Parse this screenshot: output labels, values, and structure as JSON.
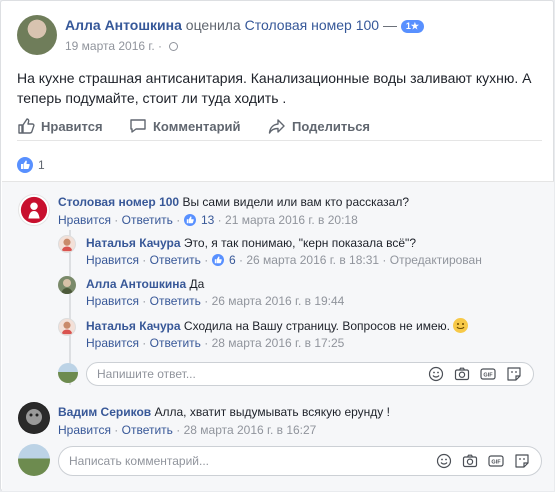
{
  "post": {
    "author": "Алла Антошкина",
    "verb": "оценила",
    "page": "Столовая номер 100",
    "dash": "—",
    "rating": "1★",
    "date": "19 марта 2016 г.",
    "dot": "·",
    "text": "На кухне страшная антисанитария. Канализационные воды заливают кухню. А теперь подумайте, стоит ли туда ходить ."
  },
  "actions": {
    "like": "Нравится",
    "comment": "Комментарий",
    "share": "Поделиться"
  },
  "reactions": {
    "count": "1"
  },
  "comments": [
    {
      "name": "Столовая номер 100",
      "text": "Вы сами видели или вам кто рассказал?",
      "like": "Нравится",
      "reply": "Ответить",
      "likes": "13",
      "date": "21 марта 2016 г. в 20:18",
      "replies": [
        {
          "name": "Наталья Качура",
          "text": "Это, я так понимаю, \"керн показала всё\"?",
          "like": "Нравится",
          "reply": "Ответить",
          "likes": "6",
          "date": "26 марта 2016 г. в 18:31",
          "extra": "Отредактирован"
        },
        {
          "name": "Алла Антошкина",
          "text": "Да",
          "like": "Нравится",
          "reply": "Ответить",
          "date": "26 марта 2016 г. в 19:44"
        },
        {
          "name": "Наталья Качура",
          "text": "Сходила на Вашу страницу. Вопросов не имею.",
          "like": "Нравится",
          "reply": "Ответить",
          "date": "28 марта 2016 г. в 17:25"
        }
      ],
      "reply_placeholder": "Напишите ответ..."
    },
    {
      "name": "Вадим Сериков",
      "text": "Алла, хватит выдумывать всякую ерунду !",
      "like": "Нравится",
      "reply": "Ответить",
      "date": "28 марта 2016 г. в 16:27"
    }
  ],
  "sep": "·",
  "comment_placeholder": "Написать комментарий...",
  "colors": {
    "link": "#365899",
    "like_blue": "#5890ff",
    "muted": "#90949c"
  }
}
